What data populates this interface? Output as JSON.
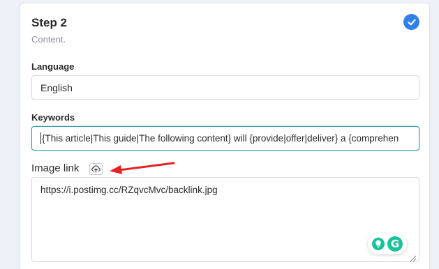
{
  "step": {
    "title": "Step 2",
    "subtitle": "Content.",
    "status_icon": "check-circle-icon",
    "accent_color": "#2f80ed"
  },
  "language": {
    "label": "Language",
    "value": "English"
  },
  "keywords": {
    "label": "Keywords",
    "value": "{This article|This guide|The following content} will {provide|offer|deliver} a {comprehen",
    "focus_color": "#3aa0a8"
  },
  "image_link": {
    "label": "Image link",
    "upload_icon": "upload-cloud-icon",
    "annotation_icon": "red-arrow-annotation",
    "annotation_color": "#e52321",
    "value": "https://i.postimg.cc/RZqvcMvc/backlink.jpg"
  },
  "grammarly": {
    "icons": [
      "grammarly-bulb-icon",
      "grammarly-logo-icon"
    ],
    "logo_letter": "G",
    "color": "#15c39a"
  }
}
